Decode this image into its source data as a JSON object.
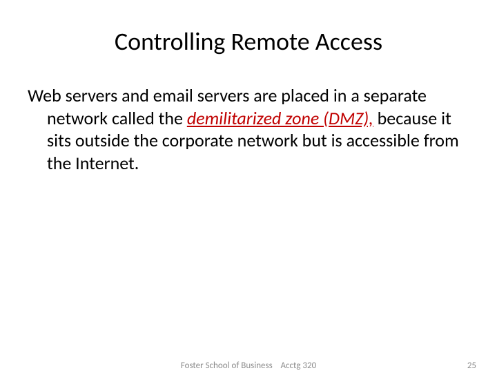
{
  "title": "Controlling Remote Access",
  "body": {
    "lead": "Web servers and email servers are placed in a separate network called the ",
    "emphasis": "demilitarized zone (DMZ),",
    "tail": " because it sits outside the corporate network but is accessible from the Internet."
  },
  "footer": {
    "school": "Foster School of Business",
    "course": "Acctg 320",
    "page": "25"
  }
}
